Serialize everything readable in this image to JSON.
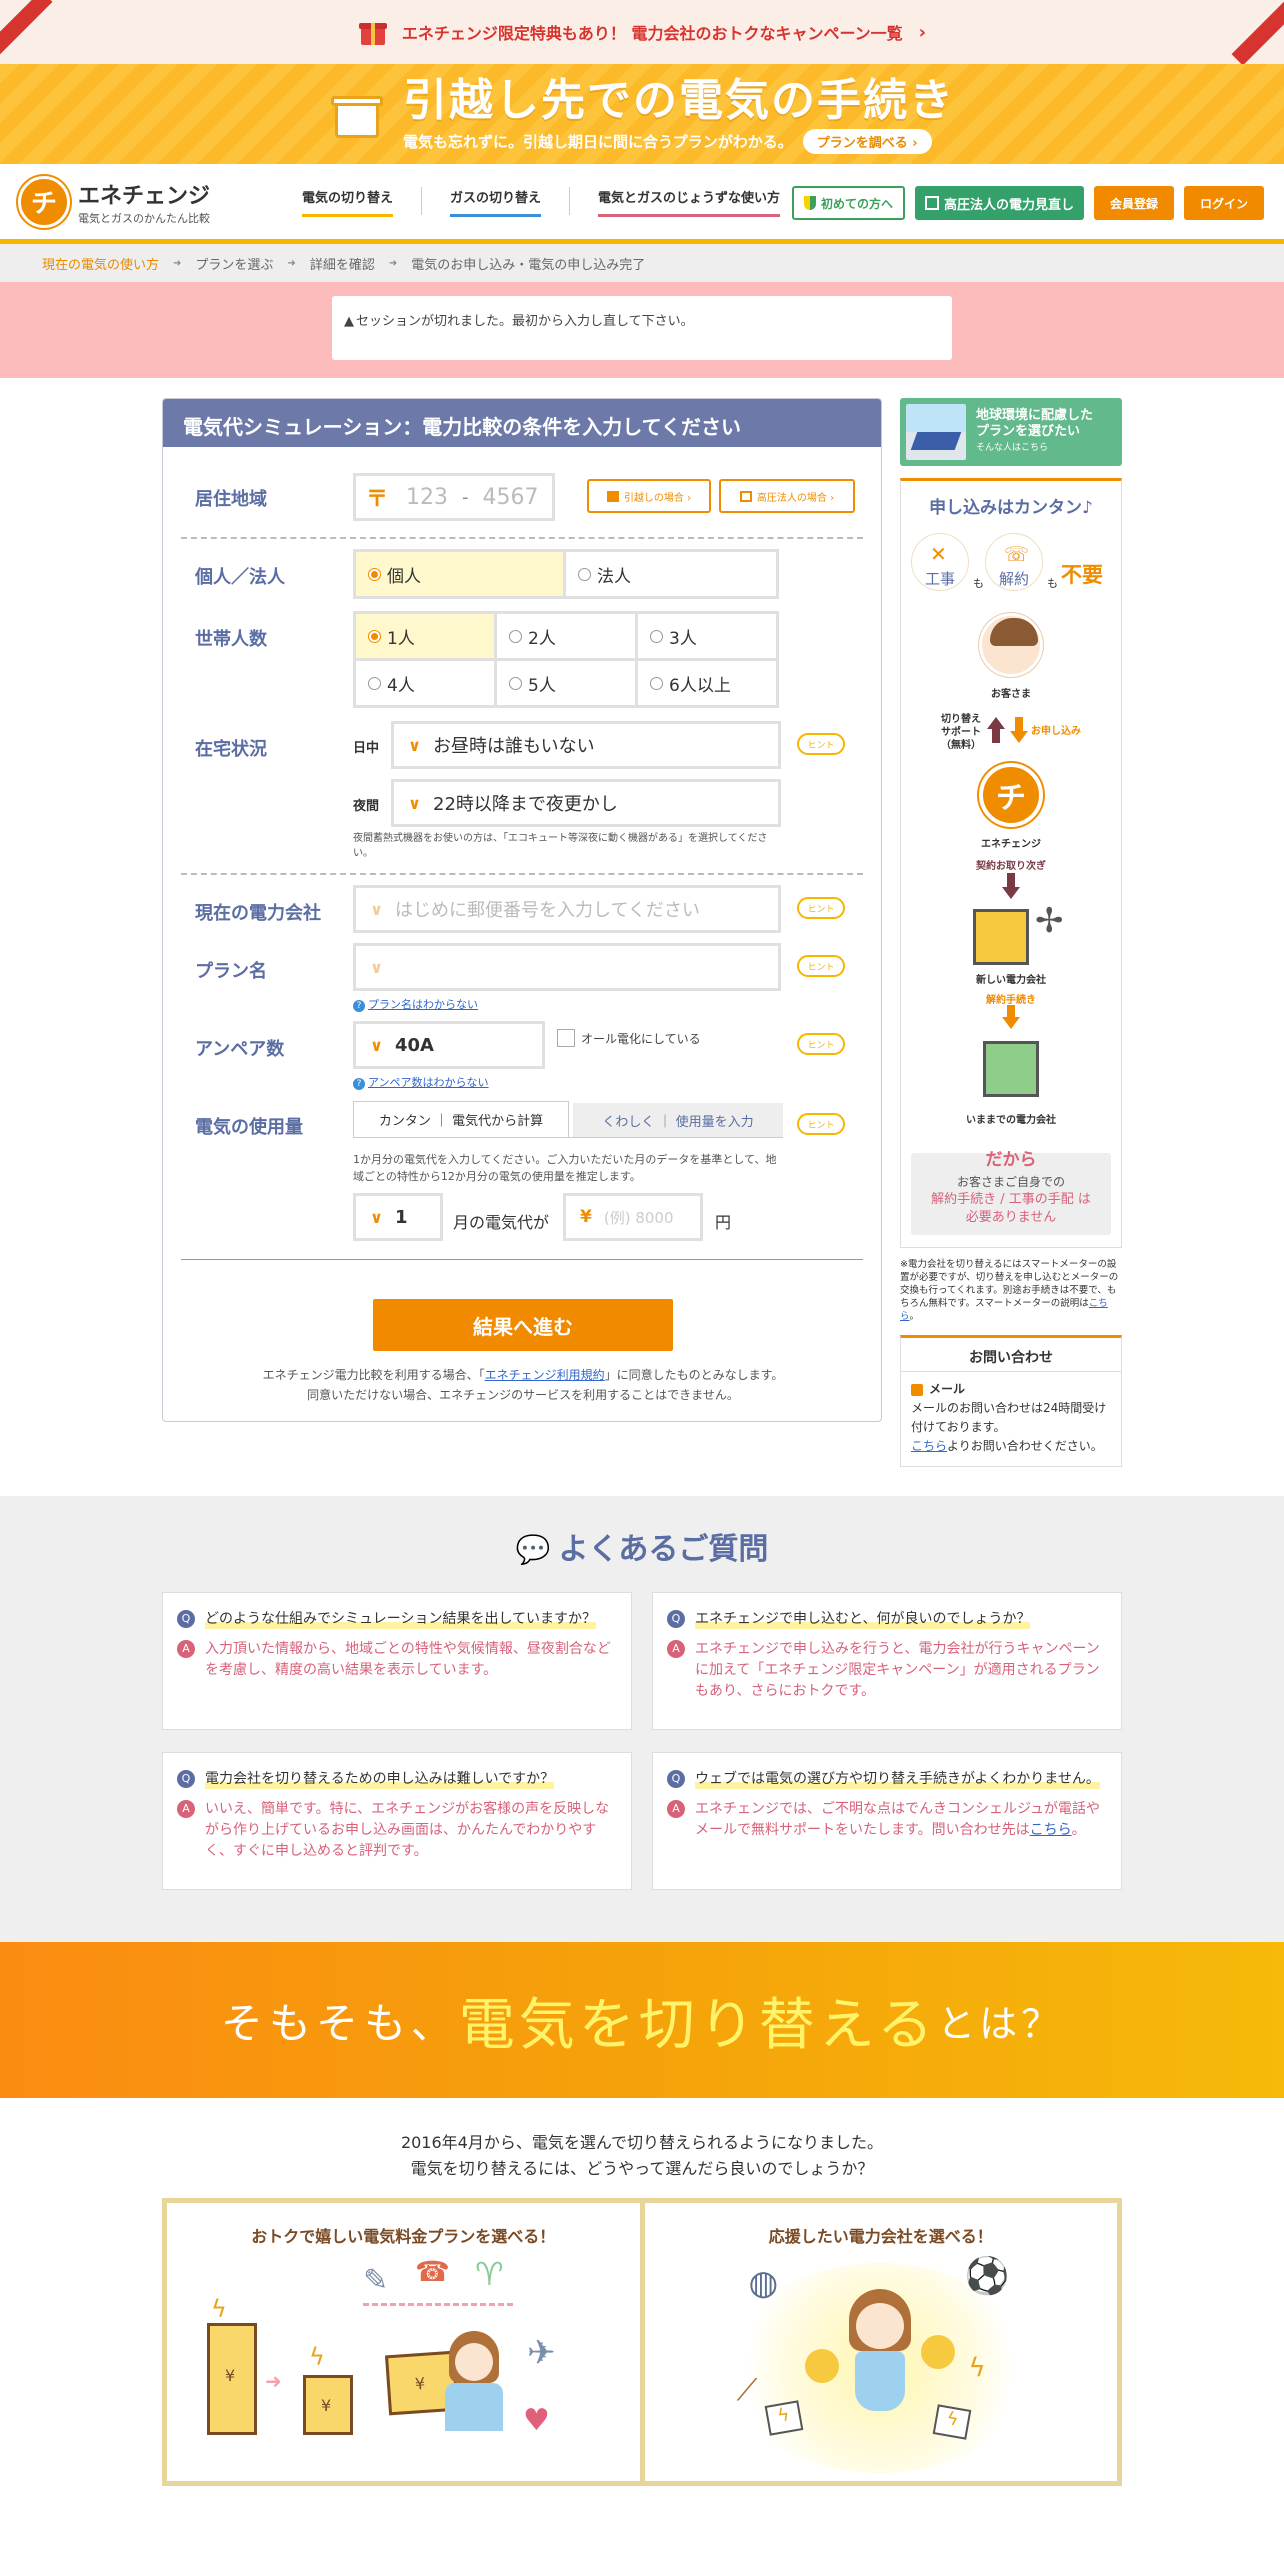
{
  "campaign_bar": {
    "text": "エネチェンジ限定特典もあり！ 電力会社のおトクなキャンペーン一覧",
    "chevron": "›"
  },
  "moving_banner": {
    "title": "引越し先での電気の手続き",
    "sub": "電気も忘れずに。引越し期日に間に合うプランがわかる。",
    "button": "プランを調べる ›"
  },
  "header": {
    "logo_mark": "チ",
    "logo_name": "エネチェンジ",
    "logo_tagline": "電気とガスのかんたん比較",
    "nav": [
      "電気の切り替え",
      "ガスの切り替え",
      "電気とガスのじょうずな使い方"
    ],
    "buttons": {
      "first": "初めての方へ",
      "high_voltage": "高圧法人の電力見直し",
      "member": "会員登録",
      "login": "ログイン"
    }
  },
  "breadcrumb": [
    "現在の電気の使い方",
    "プランを選ぶ",
    "詳細を確認",
    "電気のお申し込み・電気の申し込み完了"
  ],
  "error": {
    "icon": "▲",
    "message": "セッションが切れました。最初から入力し直して下さい。"
  },
  "form": {
    "title": "電気代シミュレーション：電力比較の条件を入力してください",
    "region": {
      "label": "居住地域",
      "zip_mark": "〒",
      "zip1_placeholder": "123",
      "zip_dash": "-",
      "zip2_placeholder": "4567",
      "moving_button": "引越しの場合 ›",
      "corporate_button": "高圧法人の場合 ›"
    },
    "customer": {
      "label": "個人／法人",
      "options": [
        "個人",
        "法人"
      ],
      "selected": "個人"
    },
    "household": {
      "label": "世帯人数",
      "options": [
        "1人",
        "2人",
        "3人",
        "4人",
        "5人",
        "6人以上"
      ],
      "selected": "1人"
    },
    "home": {
      "label": "在宅状況",
      "day_label": "日中",
      "day_value": "お昼時は誰もいない",
      "night_label": "夜間",
      "night_value": "22時以降まで夜更かし",
      "note": "夜間蓄熱式機器をお使いの方は、「エコキュート等深夜に動く機器がある」を選択してください。"
    },
    "company": {
      "label": "現在の電力会社",
      "placeholder": "はじめに郵便番号を入力してください"
    },
    "plan": {
      "label": "プラン名",
      "placeholder": "",
      "help": "プラン名はわからない"
    },
    "ampere": {
      "label": "アンペア数",
      "value": "40A",
      "all_electric": "オール電化にしている",
      "help": "アンペア数はわからない"
    },
    "usage": {
      "label": "電気の使用量",
      "tabs": [
        "カンタン ｜ 電気代から計算",
        "くわしく ｜ 使用量を入力"
      ],
      "note": "1か月分の電気代を入力してください。ご入力いただいた月のデータを基準として、地域ごとの特性から12か月分の電気の使用量を推定します。",
      "month": "1",
      "month_suffix": "月の電気代が",
      "yen_mark": "¥",
      "amount_placeholder": "(例) 8000",
      "unit": "円"
    },
    "hint": "ヒント",
    "submit": "結果へ進む",
    "terms_1": "エネチェンジ電力比較を利用する場合、「",
    "terms_link": "エネチェンジ利用規約",
    "terms_2": "」に同意したものとみなします。",
    "terms_3": "同意いただけない場合、エネチェンジのサービスを利用することはできません。"
  },
  "sidebar": {
    "eco": {
      "line1": "地球環境に配慮した",
      "line2": "プランを選びたい",
      "line3": "そんな人はこちら"
    },
    "flow": {
      "title": "申し込みはカンタン♪",
      "construction": "工事",
      "cancel": "解約",
      "mo": "も",
      "unneeded": "不要",
      "customer": "お客さま",
      "support": "切り替え\nサポート\n（無料）",
      "apply": "お申し込み",
      "enechange": "エネチェンジ",
      "contract": "契約お取り次ぎ",
      "new_company": "新しい電力会社",
      "cancel_proc": "解約手続き",
      "old_company": "いままでの電力会社",
      "dakara": "だから",
      "no_need_1": "お客さまご自身での",
      "no_need_2": "解約手続き / 工事の手配 は",
      "no_need_3": "必要ありません"
    },
    "meter_note": "※電力会社を切り替えるにはスマートメーターの設置が必要ですが、切り替えを申し込むとメーターの交換も行ってくれます。別途お手続きは不要で、もちろん無料です。スマートメーターの説明は",
    "meter_link": "こちら",
    "meter_end": "。",
    "contact": {
      "title": "お問い合わせ",
      "mail": "メール",
      "text": "メールのお問い合わせは24時間受け付けております。",
      "link": "こちら",
      "text2": "よりお問い合わせください。"
    }
  },
  "faq": {
    "title": "よくあるご質問",
    "items": [
      {
        "q": "どのような仕組みでシミュレーション結果を出していますか？",
        "a": "入力頂いた情報から、地域ごとの特性や気候情報、昼夜割合などを考慮し、精度の高い結果を表示しています。"
      },
      {
        "q": "エネチェンジで申し込むと、何が良いのでしょうか？",
        "a": "エネチェンジで申し込みを行うと、電力会社が行うキャンペーンに加えて「エネチェンジ限定キャンペーン」が適用されるプランもあり、さらにおトクです。"
      },
      {
        "q": "電力会社を切り替えるための申し込みは難しいですか？",
        "a": "いいえ、簡単です。特に、エネチェンジがお客様の声を反映しながら作り上げているお申し込み画面は、かんたんでわかりやすく、すぐに申し込めると評判です。"
      },
      {
        "q": "ウェブでは電気の選び方や切り替え手続きがよくわかりません。",
        "a": "エネチェンジでは、ご不明な点はでんきコンシェルジュが電話やメールで無料サポートをいたします。問い合わせ先は",
        "a_link": "こちら",
        "a_end": "。"
      }
    ]
  },
  "about": {
    "t1": "そもそも、",
    "t2": "電気を切り替える",
    "t3": "とは？",
    "line1": "2016年4月から、電気を選んで切り替えられるようになりました。",
    "line2": "電気を切り替えるには、どうやって選んだら良いのでしょうか？",
    "panel1": "おトクで嬉しい電気料金プランを選べる！",
    "panel2": "応援したい電力会社を選べる！",
    "yen": "¥"
  },
  "colors": {
    "accent": "#f28a00",
    "navy": "#6d7aa9",
    "pink": "#d7627a",
    "red": "#d8342f"
  }
}
